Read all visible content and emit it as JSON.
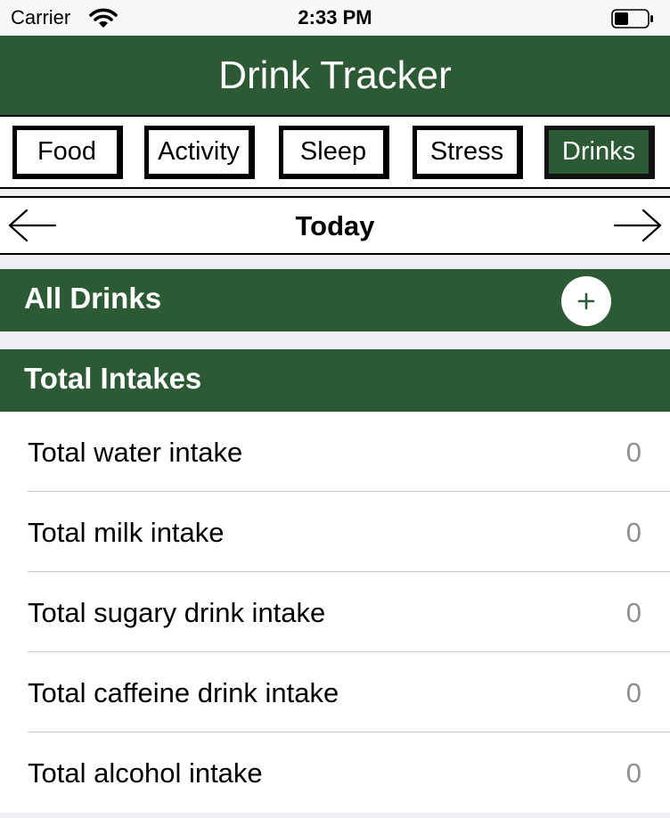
{
  "status_bar": {
    "carrier": "Carrier",
    "time": "2:33 PM"
  },
  "nav": {
    "title": "Drink Tracker"
  },
  "tabs": [
    {
      "label": "Food",
      "active": false
    },
    {
      "label": "Activity",
      "active": false
    },
    {
      "label": "Sleep",
      "active": false
    },
    {
      "label": "Stress",
      "active": false
    },
    {
      "label": "Drinks",
      "active": true
    }
  ],
  "date_nav": {
    "label": "Today"
  },
  "all_drinks": {
    "title": "All Drinks",
    "add_symbol": "+"
  },
  "total_intakes": {
    "title": "Total Intakes",
    "rows": [
      {
        "label": "Total water intake",
        "value": "0"
      },
      {
        "label": "Total milk intake",
        "value": "0"
      },
      {
        "label": "Total sugary drink intake",
        "value": "0"
      },
      {
        "label": "Total caffeine drink intake",
        "value": "0"
      },
      {
        "label": "Total alcohol intake",
        "value": "0"
      }
    ]
  },
  "colors": {
    "brand_green": "#2c5a34",
    "background": "#efeff4",
    "value_gray": "#8e8e93"
  },
  "icons": {
    "wifi": "wifi-icon",
    "battery": "battery-icon",
    "back": "arrow-left-icon",
    "forward": "arrow-right-icon",
    "add": "plus-icon"
  }
}
